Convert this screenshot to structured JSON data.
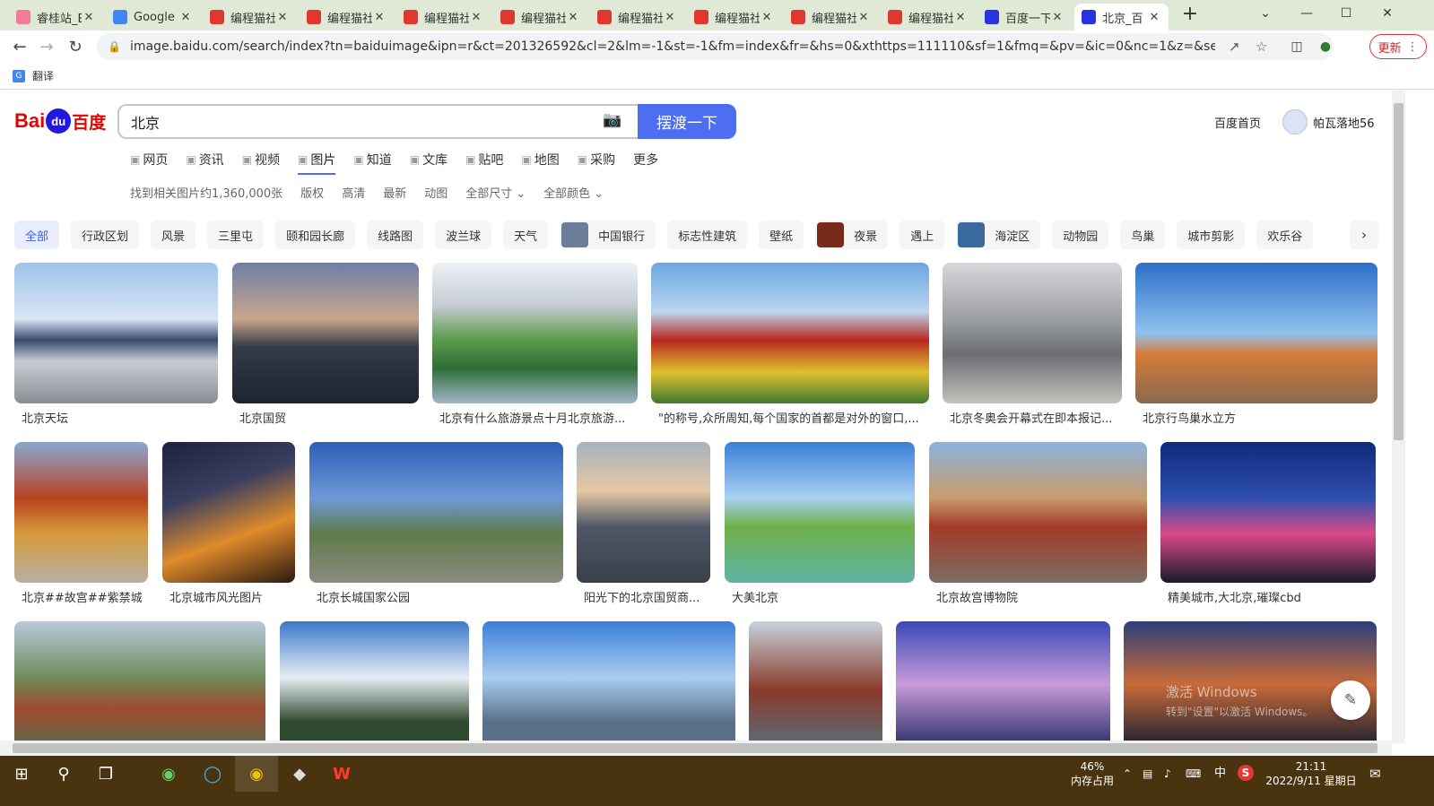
{
  "browser": {
    "tabs": [
      {
        "title": "睿桂站_E",
        "icon": "bilibili-icon",
        "color": "#f37a9a"
      },
      {
        "title": "Google",
        "icon": "google-icon",
        "color": "#4285f4"
      },
      {
        "title": "编程猫社",
        "icon": "codemao-icon",
        "color": "#e0382f"
      },
      {
        "title": "编程猫社",
        "icon": "codemao-icon",
        "color": "#e0382f"
      },
      {
        "title": "编程猫社",
        "icon": "codemao-icon",
        "color": "#e0382f"
      },
      {
        "title": "编程猫社",
        "icon": "codemao-icon",
        "color": "#e0382f"
      },
      {
        "title": "编程猫社",
        "icon": "codemao-icon",
        "color": "#e0382f"
      },
      {
        "title": "编程猫社",
        "icon": "codemao-icon",
        "color": "#e0382f"
      },
      {
        "title": "编程猫社",
        "icon": "codemao-icon",
        "color": "#e0382f"
      },
      {
        "title": "编程猫社",
        "icon": "codemao-icon",
        "color": "#e0382f"
      },
      {
        "title": "百度一下",
        "icon": "baidu-icon",
        "color": "#2932e1"
      },
      {
        "title": "北京_百",
        "icon": "baidu-icon",
        "color": "#2932e1"
      }
    ],
    "new_tab": "+",
    "url": "image.baidu.com/search/index?tn=baiduimage&ipn=r&ct=201326592&cl=2&lm=-1&st=-1&fm=index&fr=&hs=0&xthttps=111110&sf=1&fmq=&pv=&ic=0&nc=1&z=&se=1&sho...",
    "update_label": "更新",
    "bookmark": "翻译"
  },
  "search": {
    "logo_latin": "Bai",
    "logo_paw": "du",
    "logo_cn": "百度",
    "query": "北京",
    "button": "摆渡一下",
    "home_link": "百度首页",
    "username": "帕瓦落地56"
  },
  "verticals": [
    {
      "label": "网页",
      "icon": "magnifier-icon"
    },
    {
      "label": "资讯",
      "icon": "news-icon"
    },
    {
      "label": "视频",
      "icon": "video-icon"
    },
    {
      "label": "图片",
      "icon": "image-icon"
    },
    {
      "label": "知道",
      "icon": "question-icon"
    },
    {
      "label": "文库",
      "icon": "doc-icon"
    },
    {
      "label": "贴吧",
      "icon": "tieba-icon"
    },
    {
      "label": "地图",
      "icon": "map-icon"
    },
    {
      "label": "采购",
      "icon": "cart-icon"
    },
    {
      "label": "更多",
      "icon": ""
    }
  ],
  "filters": {
    "count": "找到相关图片约1,360,000张",
    "items": [
      "版权",
      "高清",
      "最新",
      "动图",
      "全部尺寸",
      "全部颜色"
    ]
  },
  "chips": [
    {
      "label": "全部"
    },
    {
      "label": "行政区划"
    },
    {
      "label": "风景"
    },
    {
      "label": "三里屯"
    },
    {
      "label": "颐和园长廊"
    },
    {
      "label": "线路图"
    },
    {
      "label": "波兰球"
    },
    {
      "label": "天气"
    },
    {
      "label": "中国银行",
      "thumb": "#6b7d97"
    },
    {
      "label": "标志性建筑"
    },
    {
      "label": "壁纸"
    },
    {
      "label": "夜景",
      "thumb": "#7a2a1a"
    },
    {
      "label": "遇上"
    },
    {
      "label": "海淀区",
      "thumb": "#3a6aa0"
    },
    {
      "label": "动物园"
    },
    {
      "label": "鸟巢"
    },
    {
      "label": "城市剪影"
    },
    {
      "label": "欢乐谷"
    }
  ],
  "results": [
    {
      "caption": "北京天坛"
    },
    {
      "caption": "北京国贸"
    },
    {
      "caption": "北京有什么旅游景点十月北京旅游..."
    },
    {
      "caption": "\"的称号,众所周知,每个国家的首都是对外的窗口,..."
    },
    {
      "caption": "北京冬奥会开幕式在即本报记..."
    },
    {
      "caption": "北京行鸟巢水立方"
    },
    {
      "caption": "北京##故宫##紫禁城"
    },
    {
      "caption": "北京城市风光图片"
    },
    {
      "caption": "北京长城国家公园"
    },
    {
      "caption": "阳光下的北京国贸商..."
    },
    {
      "caption": "大美北京"
    },
    {
      "caption": "北京故宫博物院"
    },
    {
      "caption": "精美城市,大北京,璀璨cbd"
    },
    {
      "caption": ""
    },
    {
      "caption": ""
    },
    {
      "caption": ""
    },
    {
      "caption": ""
    },
    {
      "caption": ""
    },
    {
      "caption": ""
    }
  ],
  "watermark": {
    "line1": "激活 Windows",
    "line2": "转到\"设置\"以激活 Windows。"
  },
  "taskbar": {
    "mem_pct": "46%",
    "mem_label": "内存占用",
    "ime": "中",
    "time": "21:11",
    "date": "2022/9/11 星期日"
  },
  "colors": {
    "accent": "#4e6ef2",
    "taskbar": "#4a3410",
    "tabbar": "#dfe9d5"
  }
}
